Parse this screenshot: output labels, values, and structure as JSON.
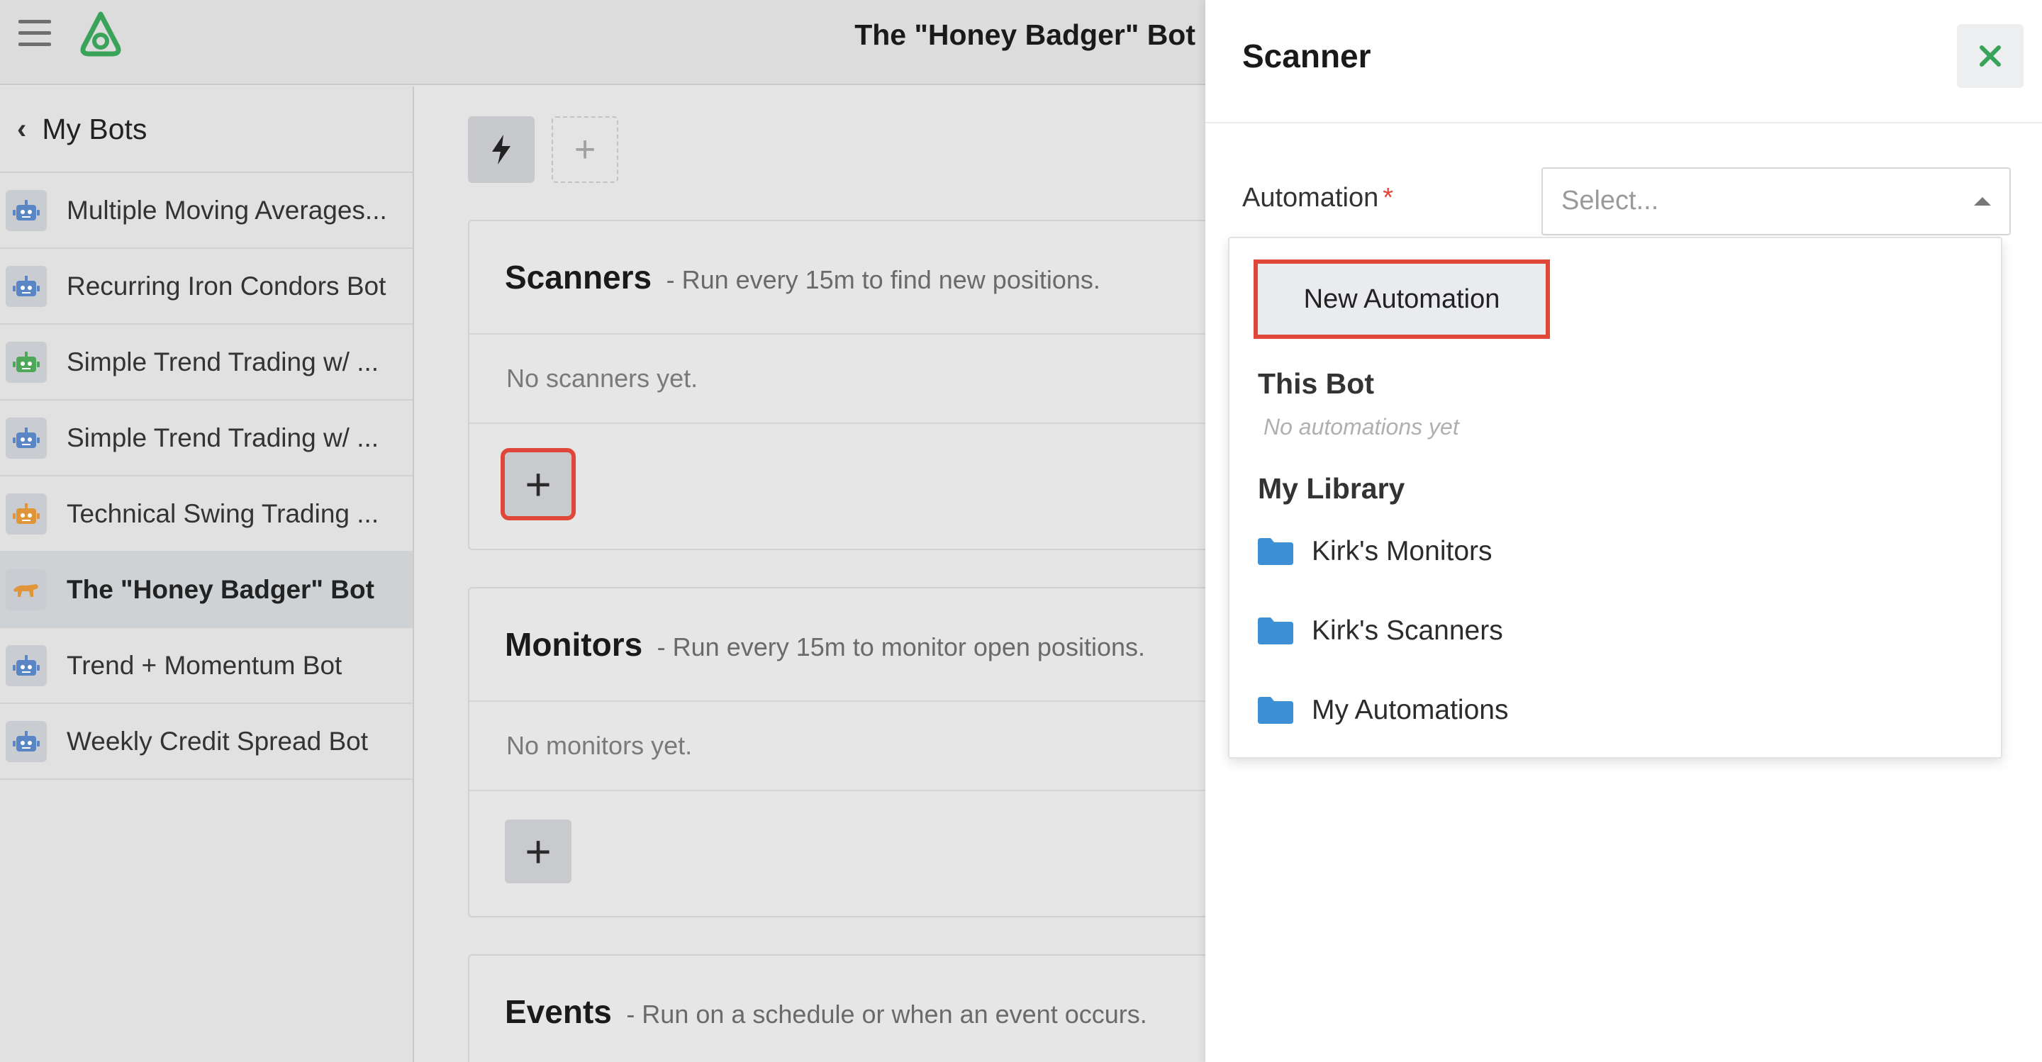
{
  "header": {
    "title": "The \"Honey Badger\" Bot"
  },
  "sidebar": {
    "back_label": "My Bots",
    "items": [
      {
        "label": "Multiple Moving Averages...",
        "color": "#5a86c5"
      },
      {
        "label": "Recurring Iron Condors Bot",
        "color": "#5a86c5"
      },
      {
        "label": "Simple Trend Trading w/ ...",
        "color": "#4fa85a"
      },
      {
        "label": "Simple Trend Trading w/ ...",
        "color": "#5a86c5"
      },
      {
        "label": "Technical Swing Trading ...",
        "color": "#e0953a"
      },
      {
        "label": "The \"Honey Badger\" Bot",
        "color": "#e0953a",
        "active": true
      },
      {
        "label": "Trend + Momentum Bot",
        "color": "#5a86c5"
      },
      {
        "label": "Weekly Credit Spread Bot",
        "color": "#5a86c5"
      }
    ]
  },
  "main": {
    "scanners": {
      "title": "Scanners",
      "subtitle": "- Run every 15m to find new positions.",
      "empty": "No scanners yet."
    },
    "monitors": {
      "title": "Monitors",
      "subtitle": "- Run every 15m to monitor open positions.",
      "empty": "No monitors yet."
    },
    "events": {
      "title": "Events",
      "subtitle": "- Run on a schedule or when an event occurs."
    },
    "add_symbol": "+"
  },
  "drawer": {
    "title": "Scanner",
    "field_label": "Automation",
    "required_mark": "*",
    "select_placeholder": "Select...",
    "dropdown": {
      "new_automation": "New Automation",
      "this_bot_title": "This Bot",
      "this_bot_empty": "No automations yet",
      "library_title": "My Library",
      "folders": [
        "Kirk's Monitors",
        "Kirk's Scanners",
        "My Automations"
      ]
    }
  },
  "colors": {
    "accent_green": "#3aa35a",
    "highlight_red": "#e0473b",
    "folder_blue": "#3d8fd6"
  }
}
